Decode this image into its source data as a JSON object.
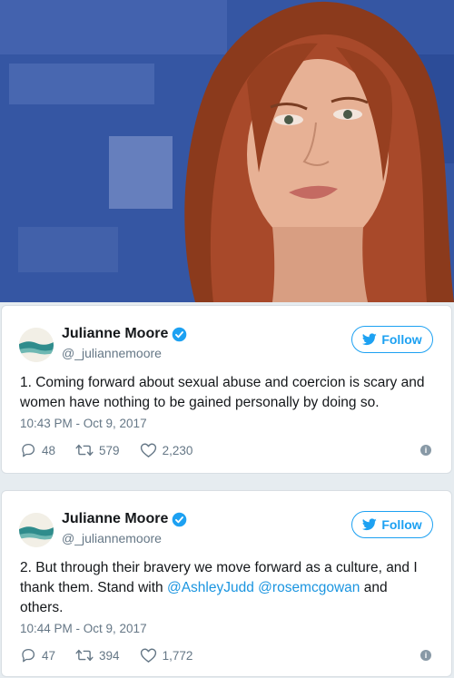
{
  "photo": {
    "description_icon": "portrait-photo"
  },
  "tweets": [
    {
      "name": "Julianne Moore",
      "handle": "@_juliannemoore",
      "follow_label": "Follow",
      "text_parts": [
        "1. Coming forward about sexual abuse and coercion is scary and women have nothing to be gained personally by doing so."
      ],
      "time": "10:43 PM - Oct 9, 2017",
      "replies": "48",
      "retweets": "579",
      "likes": "2,230"
    },
    {
      "name": "Julianne Moore",
      "handle": "@_juliannemoore",
      "follow_label": "Follow",
      "text_before": "2. But through their bravery we move forward as a culture, and I thank them. Stand with ",
      "mention1": "@AshleyJudd",
      "mention2": "@rosemcgowan",
      "text_after": " and others.",
      "time": "10:44 PM - Oct 9, 2017",
      "replies": "47",
      "retweets": "394",
      "likes": "1,772"
    }
  ],
  "colors": {
    "accent": "#1da1f2",
    "mention": "#1b95e0",
    "meta": "#657786"
  }
}
